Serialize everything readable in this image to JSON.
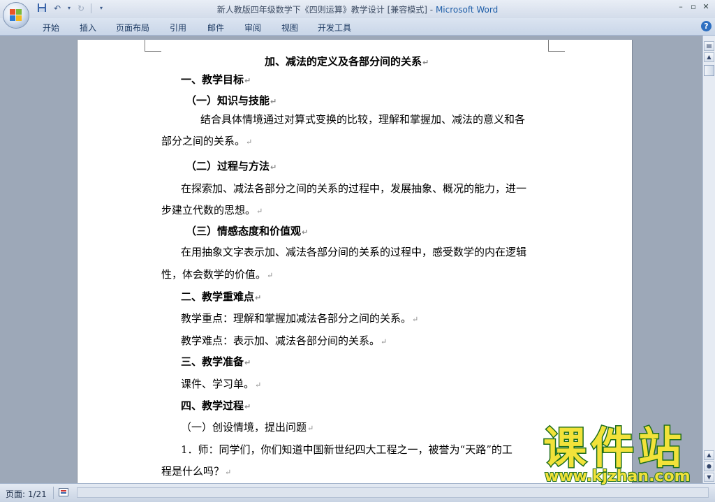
{
  "window": {
    "title_doc": "新人教版四年级数学下《四则运算》教学设计",
    "title_mode": "[兼容模式]",
    "title_sep": " - ",
    "title_app": "Microsoft Word"
  },
  "qat": {
    "save_icon": "save-icon",
    "undo_icon": "undo-icon",
    "redo_icon": "redo-icon",
    "customize_icon": "dropdown-icon"
  },
  "tabs": [
    "开始",
    "插入",
    "页面布局",
    "引用",
    "邮件",
    "审阅",
    "视图",
    "开发工具"
  ],
  "document": {
    "title": "加、减法的定义及各部分间的关系",
    "h1": "一、教学目标",
    "h1_1": "（一）知识与技能",
    "p1a": "结合具体情境通过对算式变换的比较，理解和掌握加、减法的意义和各",
    "p1b": "部分之间的关系。",
    "h1_2": "（二）过程与方法",
    "p2a": "在探索加、减法各部分之间的关系的过程中，发展抽象、概况的能力，进一",
    "p2b": "步建立代数的思想。",
    "h1_3": "（三）情感态度和价值观",
    "p3a": "在用抽象文字表示加、减法各部分间的关系的过程中，感受数学的内在逻辑",
    "p3b": "性，体会数学的价值。",
    "h2": "二、教学重难点",
    "p4": "教学重点：理解和掌握加减法各部分之间的关系。",
    "p5": "教学难点：表示加、减法各部分间的关系。",
    "h3": "三、教学准备",
    "p6": "课件、学习单。",
    "h4": "四、教学过程",
    "p7": "（一）创设情境，提出问题",
    "p8a": "1．师：同学们，你们知道中国新世纪四大工程之一，被誉为“天路”的工",
    "p8b": "程是什么吗？",
    "para_mark": "↵"
  },
  "status": {
    "page": "页面: 1/21"
  },
  "watermark": {
    "main": "课件站",
    "url": "www.kjzhan.com"
  },
  "colors": {
    "app_title": "#1f5ea8",
    "watermark_fill": "#f2e23a",
    "watermark_stroke": "#1d6d1d"
  }
}
